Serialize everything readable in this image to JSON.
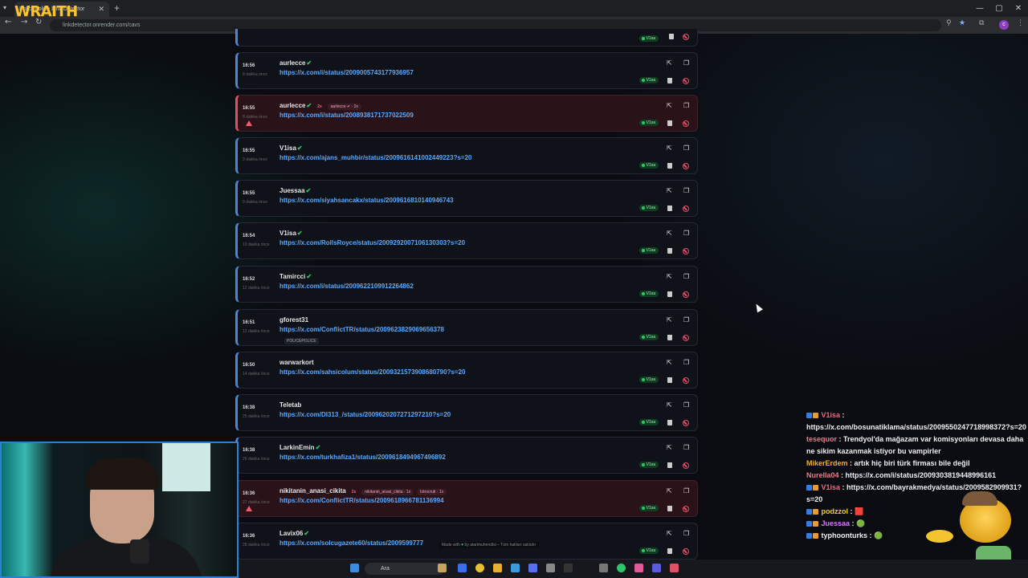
{
  "browser": {
    "tab_title": "PolicePolice Link Detector",
    "stream_logo": "WRAITH",
    "url": "linkdetector.onrender.com/cavs"
  },
  "entries": [
    {
      "time": "16:56",
      "ago": "8 dakika önce",
      "user": "aurlecce",
      "verified": true,
      "link": "https://x.com/i/status/2009005743177936957",
      "flagged": false,
      "status": "V1sa"
    },
    {
      "time": "16:55",
      "ago": "8 dakika önce",
      "user": "aurlecce",
      "verified": true,
      "link": "https://x.com/i/status/2008938171737022509",
      "flagged": true,
      "dup_badge": "2x",
      "dup_pills": [
        "aurlecce ✔ · 2x"
      ],
      "status": "V1sa"
    },
    {
      "time": "16:55",
      "ago": "9 dakika önce",
      "user": "V1isa",
      "verified": true,
      "link": "https://x.com/ajans_muhbir/status/2009616141002449223?s=20",
      "flagged": false,
      "status": "V1sa"
    },
    {
      "time": "16:55",
      "ago": "9 dakika önce",
      "user": "Juessaa",
      "verified": true,
      "link": "https://x.com/siyahsancakx/status/2009616810140946743",
      "flagged": false,
      "status": "V1sa"
    },
    {
      "time": "16:54",
      "ago": "10 dakika önce",
      "user": "V1isa",
      "verified": true,
      "link": "https://x.com/RollsRoyce/status/2009292007106130303?s=20",
      "flagged": false,
      "status": "V1sa"
    },
    {
      "time": "16:52",
      "ago": "12 dakika önce",
      "user": "Tamircci",
      "verified": true,
      "link": "https://x.com/i/status/2009622109912264862",
      "flagged": false,
      "status": "V1sa"
    },
    {
      "time": "16:51",
      "ago": "12 dakika önce",
      "user": "gforest31",
      "verified": false,
      "link": "https://x.com/ConflictTR/status/2009623829069656378",
      "flagged": false,
      "sub": "POLICEPOLICE",
      "status": "V1sa"
    },
    {
      "time": "16:50",
      "ago": "14 dakika önce",
      "user": "warwarkort",
      "verified": false,
      "link": "https://x.com/sahsicolum/status/2009321573908680790?s=20",
      "flagged": false,
      "status": "V1sa"
    },
    {
      "time": "16:38",
      "ago": "25 dakika önce",
      "user": "Teletab",
      "verified": false,
      "link": "https://x.com/DI313_/status/2009620207271297210?s=20",
      "flagged": false,
      "status": "V1sa"
    },
    {
      "time": "16:38",
      "ago": "26 dakika önce",
      "user": "LarkinEmin",
      "verified": true,
      "link": "https://x.com/turkhafiza1/status/2009618494967496892",
      "flagged": false,
      "status": "V1sa"
    },
    {
      "time": "16:36",
      "ago": "27 dakika önce",
      "user": "nikitanin_anasi_cikita",
      "verified": false,
      "link": "https://x.com/ConflictTR/status/2009618966781136994",
      "flagged": true,
      "dup_badge": "2x",
      "dup_pills": [
        "nikitanin_anasi_cikita · 1x",
        "lotrocruti · 1x"
      ],
      "status": "V1sa"
    },
    {
      "time": "16:36",
      "ago": "28 dakika önce",
      "user": "Lavix06",
      "verified": true,
      "link": "https://x.com/solcugazete60/status/2009599777",
      "flagged": false,
      "status": "V1sa"
    }
  ],
  "footer": {
    "made_with": "Made with",
    "by": "by",
    "author": "atarimuhendisi",
    "rights": "– Tüm hakları saklıdır"
  },
  "chat": [
    {
      "user": "V1isa",
      "color": "#f06a84",
      "text": "https://x.com/bosunatiklama/status/2009550247718998372?s=20",
      "badges": true
    },
    {
      "user": "tesequor",
      "color": "#f07a8a",
      "text": "Trendyol'da mağazam var komisyonları devasa daha ne sikim kazanmak istiyor bu vampirler",
      "badges": false
    },
    {
      "user": "MikerErdem",
      "color": "#f0b030",
      "text": "artık hiç biri türk firması bile değil",
      "badges": false
    },
    {
      "user": "Nurella04",
      "color": "#f07a8a",
      "text": "https://x.com/i/status/2009303819448996161",
      "badges": false
    },
    {
      "user": "V1isa",
      "color": "#f06a84",
      "text": "https://x.com/bayrakmedya/status/2009582909931?s=20",
      "badges": true
    },
    {
      "user": "podzzol",
      "color": "#f0d030",
      "text": "🟥",
      "badges": true
    },
    {
      "user": "Juessaa",
      "color": "#d080f0",
      "text": "🟢",
      "badges": true
    },
    {
      "user": "typhoonturks",
      "color": "#f0f0f0",
      "text": "🟢",
      "badges": true
    }
  ],
  "taskbar": {
    "search_label": "Ara"
  }
}
